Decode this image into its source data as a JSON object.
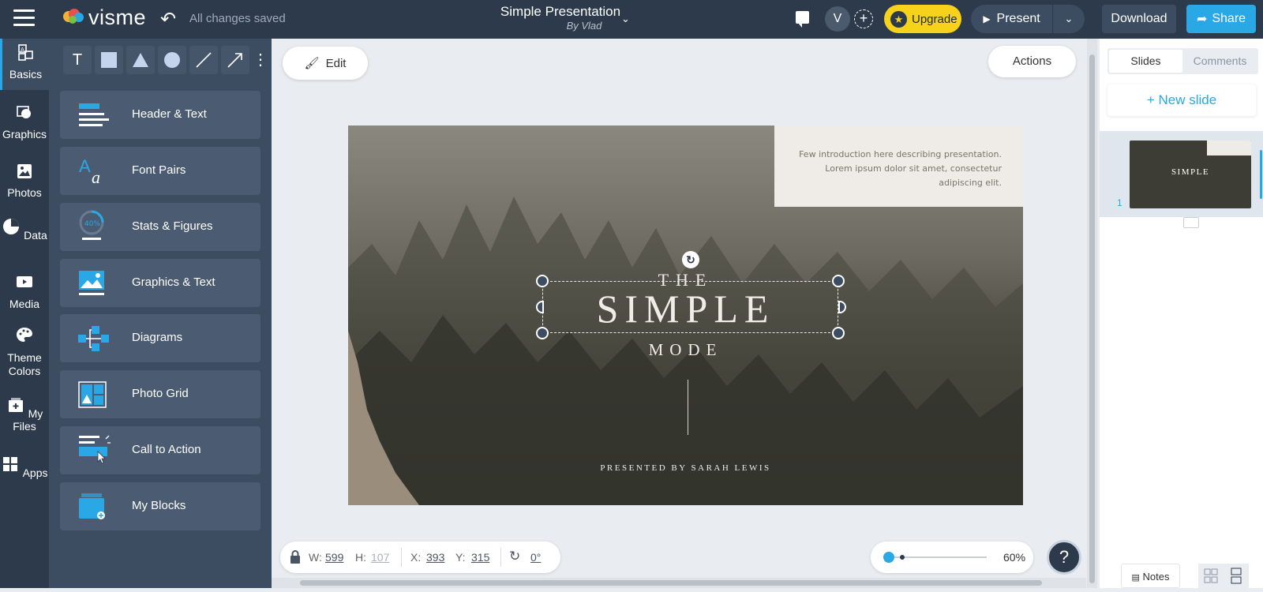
{
  "app": {
    "logo_text": "visme",
    "save_status": "All changes saved"
  },
  "document": {
    "title": "Simple Presentation",
    "author": "By Vlad"
  },
  "header": {
    "avatar_initial": "V",
    "upgrade_label": "Upgrade",
    "present_label": "Present",
    "download_label": "Download",
    "share_label": "Share"
  },
  "leftnav": {
    "items": [
      {
        "label": "Basics",
        "icon": "basics-icon",
        "active": true
      },
      {
        "label": "Graphics",
        "icon": "graphics-icon"
      },
      {
        "label": "Photos",
        "icon": "photos-icon"
      },
      {
        "label": "Data",
        "icon": "data-icon"
      },
      {
        "label": "Media",
        "icon": "media-icon"
      },
      {
        "label": "Theme Colors",
        "label_line1": "Theme",
        "label_line2": "Colors",
        "icon": "palette-icon"
      },
      {
        "label": "My Files",
        "icon": "my-files-icon"
      },
      {
        "label": "Apps",
        "icon": "apps-icon"
      }
    ]
  },
  "tools": {
    "items": [
      "text-tool",
      "rectangle-tool",
      "triangle-tool",
      "circle-tool",
      "line-tool",
      "arrow-tool",
      "more-tool"
    ],
    "text_glyph": "T"
  },
  "blocks": {
    "items": [
      {
        "label": "Header & Text"
      },
      {
        "label": "Font Pairs"
      },
      {
        "label": "Stats & Figures",
        "badge": "40%"
      },
      {
        "label": "Graphics & Text"
      },
      {
        "label": "Diagrams"
      },
      {
        "label": "Photo Grid"
      },
      {
        "label": "Call to Action"
      },
      {
        "label": "My Blocks"
      }
    ]
  },
  "canvas": {
    "edit_label": "Edit",
    "actions_label": "Actions"
  },
  "slide": {
    "intro_text": "Few introduction here describing presentation. Lorem ipsum dolor sit amet, consectetur adipiscing elit.",
    "the": "THE",
    "title": "SIMPLE",
    "subtitle": "MODE",
    "presented_by": "PRESENTED BY SARAH LEWIS"
  },
  "selection": {
    "w_label": "W:",
    "w_value": "599",
    "h_label": "H:",
    "h_value": "107",
    "x_label": "X:",
    "x_value": "393",
    "y_label": "Y:",
    "y_value": "315",
    "rotation_value": "0°"
  },
  "zoom": {
    "value": 0.6,
    "label": "60%"
  },
  "right_panel": {
    "tab_slides": "Slides",
    "tab_comments": "Comments",
    "new_slide_label": "+ New slide",
    "slide_number": "1",
    "thumb_title": "SIMPLE",
    "notes_label": "Notes"
  },
  "colors": {
    "topbar": "#2c3a4b",
    "panel": "#3d4d61",
    "accent": "#2aa8e5",
    "upgrade": "#f7d21a"
  }
}
